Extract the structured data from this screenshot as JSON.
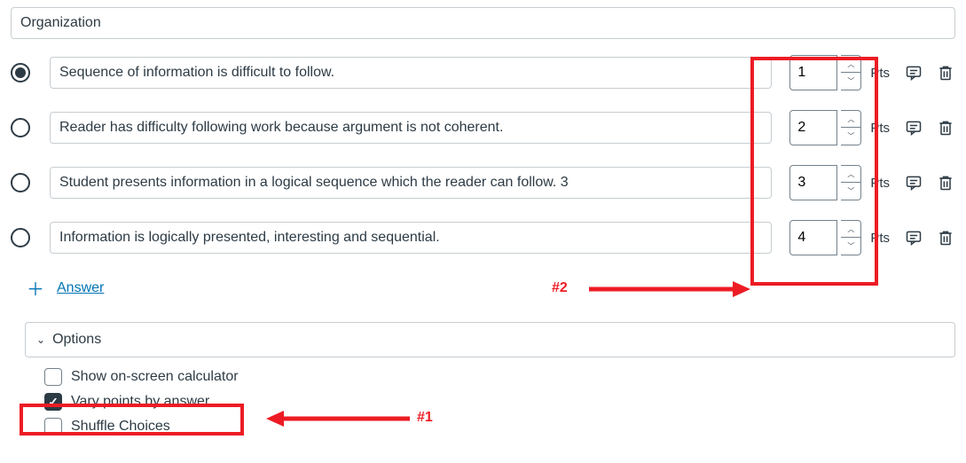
{
  "title": "Organization",
  "choices": [
    {
      "text": "Sequence of information is difficult to follow.",
      "points": "1",
      "selected": true
    },
    {
      "text": "Reader has difficulty following work because argument is not coherent.",
      "points": "2",
      "selected": false
    },
    {
      "text": "Student presents information in a logical sequence which the reader can follow. 3",
      "points": "3",
      "selected": false
    },
    {
      "text": "Information is logically presented, interesting and sequential.",
      "points": "4",
      "selected": false
    }
  ],
  "pts_label": "Pts",
  "add_answer_label": "Answer",
  "options_header": "Options",
  "options": {
    "calculator": {
      "label": "Show on-screen calculator",
      "checked": false
    },
    "vary_points": {
      "label": "Vary points by answer",
      "checked": true
    },
    "shuffle": {
      "label": "Shuffle Choices",
      "checked": false
    }
  },
  "annotations": {
    "label1": "#1",
    "label2": "#2"
  }
}
